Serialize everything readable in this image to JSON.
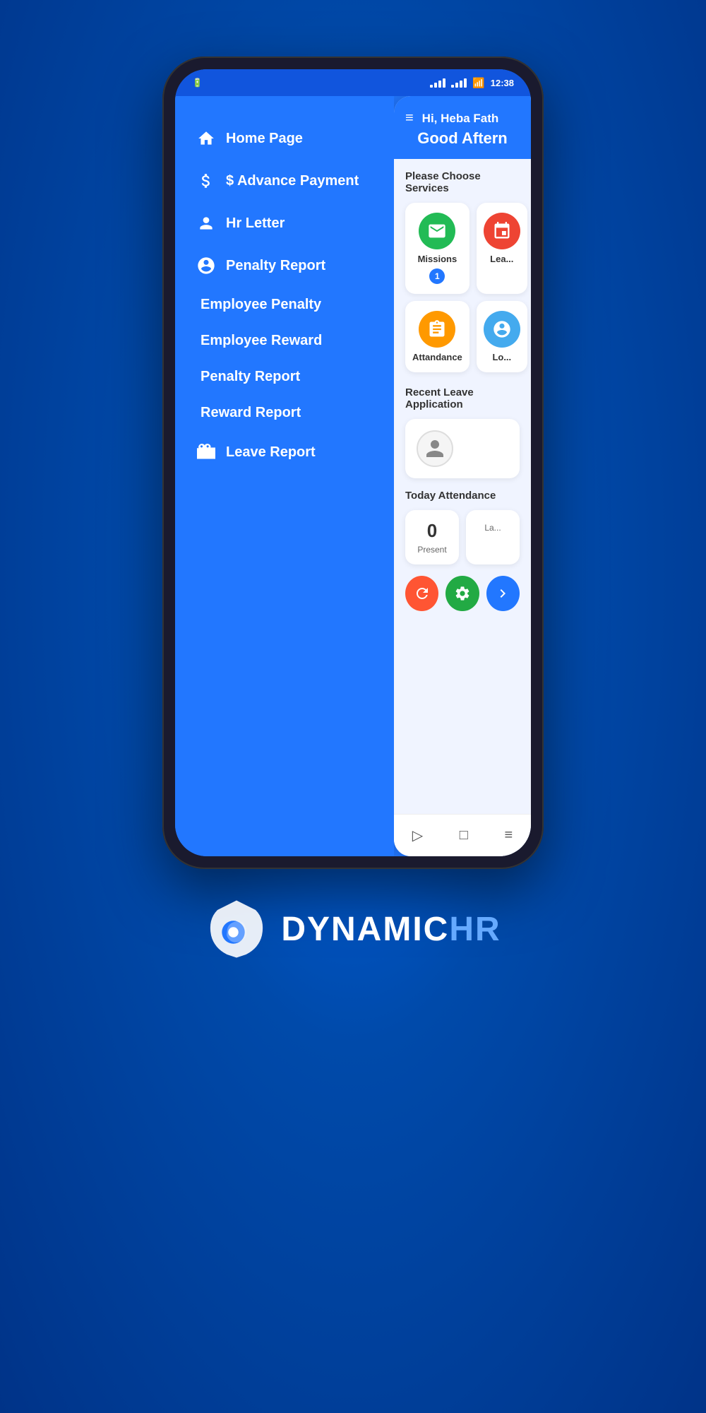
{
  "status_bar": {
    "time": "12:38",
    "battery": "🔋",
    "wifi": "WiFi",
    "signal1": "signal",
    "signal2": "signal"
  },
  "sidebar": {
    "items": [
      {
        "label": "Home Page",
        "icon": "home"
      },
      {
        "label": "Advance Payment",
        "icon": "dollar"
      },
      {
        "label": "Hr Letter",
        "icon": "person"
      },
      {
        "label": "Penalty Report",
        "icon": "account-circle"
      }
    ],
    "sub_items": [
      {
        "label": "Employee Penalty"
      },
      {
        "label": "Employee Reward"
      },
      {
        "label": "Penalty Report"
      },
      {
        "label": "Reward Report"
      },
      {
        "label": "Leave Report",
        "icon": "briefcase"
      }
    ]
  },
  "header": {
    "hamburger_label": "≡",
    "greeting_name": "Hi, Heba Fath",
    "greeting_time": "Good Aftern"
  },
  "services": {
    "section_title": "Please Choose Services",
    "items": [
      {
        "label": "Missions",
        "badge": "1",
        "color": "#22bb55",
        "icon": "✉"
      },
      {
        "label": "Lea...",
        "badge": "",
        "color": "#ee4433",
        "icon": "📅"
      },
      {
        "label": "Attandance",
        "badge": "",
        "color": "#ff9900",
        "icon": "📋"
      },
      {
        "label": "Lo...",
        "badge": "",
        "color": "#44aaee",
        "icon": "👤"
      }
    ]
  },
  "recent_leave": {
    "section_title": "Recent Leave Application",
    "avatar_icon": "👤"
  },
  "attendance": {
    "section_title": "Today Attendance",
    "cards": [
      {
        "number": "0",
        "label": "Present"
      },
      {
        "number": "",
        "label": "La..."
      }
    ]
  },
  "fab_buttons": [
    {
      "color": "#ff5533",
      "icon": "🔄"
    },
    {
      "color": "#22aa44",
      "icon": "⚙"
    },
    {
      "color": "#2277ff",
      "icon": ">"
    }
  ],
  "bottom_nav": {
    "back": "▷",
    "home": "□",
    "menu": "≡"
  },
  "brand": {
    "name_part1": "DYNAMIC",
    "name_part2": "HR"
  }
}
